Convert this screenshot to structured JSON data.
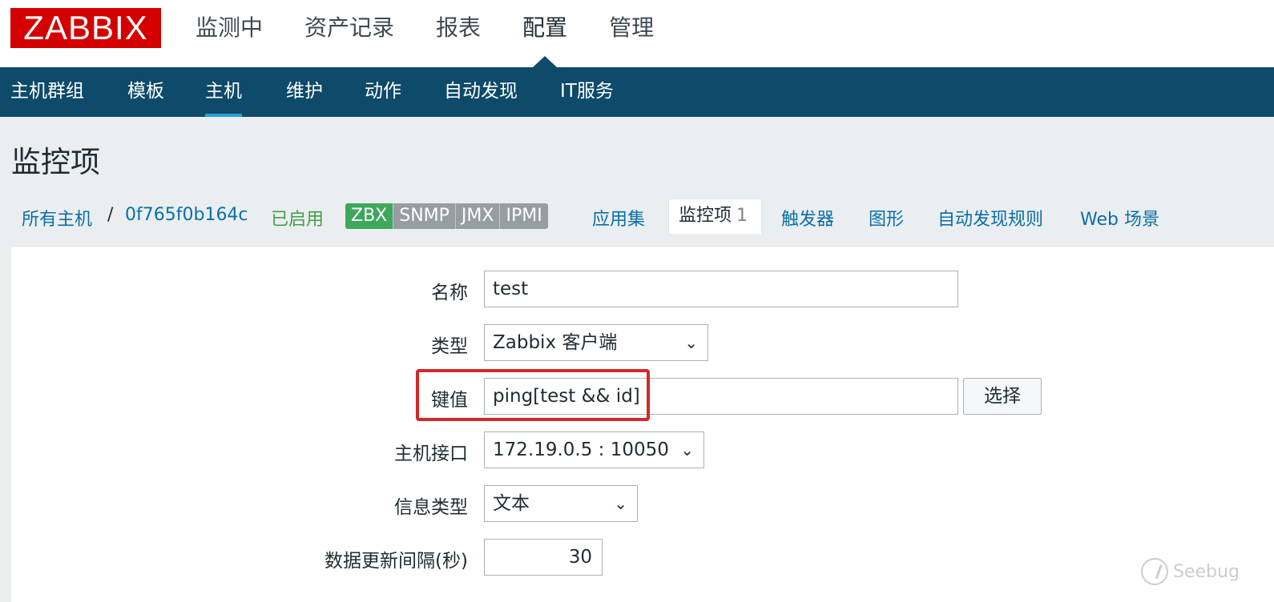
{
  "logo": "ZABBIX",
  "main_menu": [
    "监测中",
    "资产记录",
    "报表",
    "配置",
    "管理"
  ],
  "sub_menu": [
    "主机群组",
    "模板",
    "主机",
    "维护",
    "动作",
    "自动发现",
    "IT服务"
  ],
  "page_title": "监控项",
  "breadcrumb": {
    "all_hosts": "所有主机",
    "separator": "/",
    "host": "0f765f0b164c"
  },
  "status": "已启用",
  "availability": [
    "ZBX",
    "SNMP",
    "JMX",
    "IPMI"
  ],
  "tabs": {
    "applications": "应用集",
    "items": "监控项",
    "items_count": "1",
    "triggers": "触发器",
    "graphs": "图形",
    "discovery": "自动发现规则",
    "web": "Web 场景"
  },
  "form": {
    "name_label": "名称",
    "name_value": "test",
    "type_label": "类型",
    "type_value": "Zabbix 客户端",
    "key_label": "键值",
    "key_value": "ping[test && id]",
    "select_button": "选择",
    "interface_label": "主机接口",
    "interface_value": "172.19.0.5 : 10050",
    "info_type_label": "信息类型",
    "info_type_value": "文本",
    "interval_label": "数据更新间隔(秒)",
    "interval_value": "30"
  },
  "watermark": "Seebug",
  "colors": {
    "logo_red": "#d40000",
    "nav_blue": "#0e4a69",
    "link_blue": "#0a6fa8",
    "enabled_green": "#429e47",
    "highlight_red": "#d12a2a"
  },
  "icons": {
    "dropdown": "chevron-down-icon",
    "watermark": "seebug-logo-icon"
  }
}
